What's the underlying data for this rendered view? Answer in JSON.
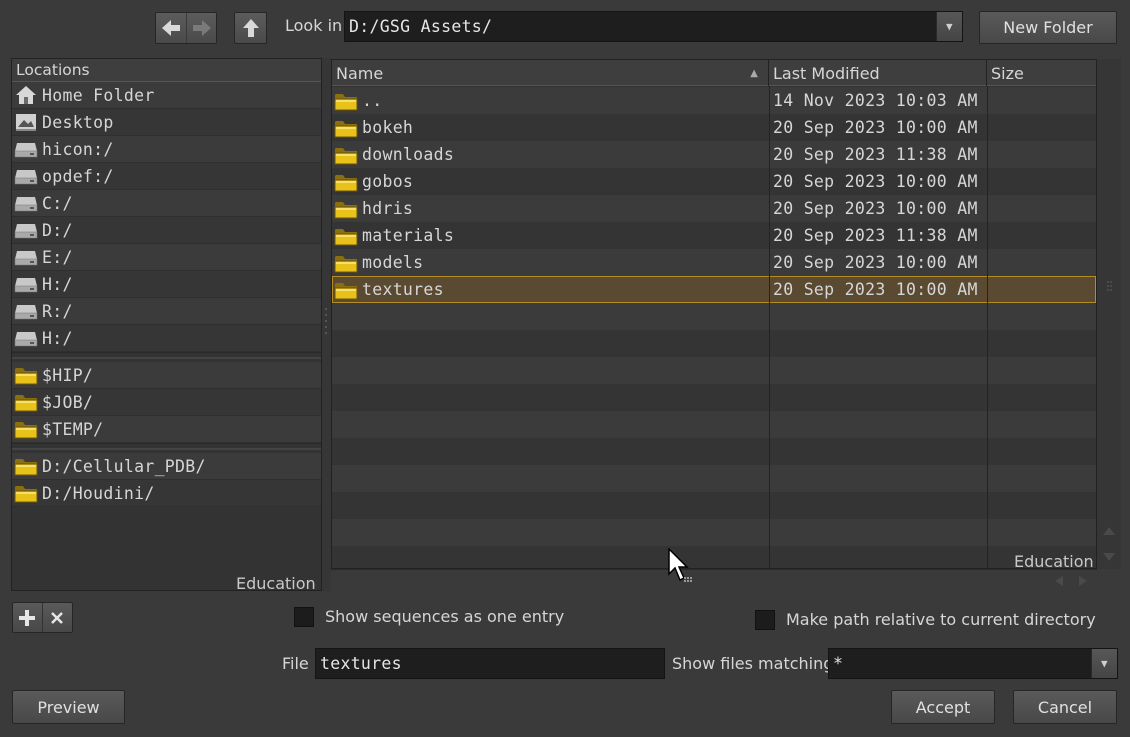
{
  "toolbar": {
    "back_icon": "arrow-left-icon",
    "forward_icon": "arrow-right-icon",
    "up_icon": "arrow-up-icon",
    "look_in_label": "Look in",
    "look_in_value": "D:/GSG Assets/",
    "new_folder_label": "New Folder"
  },
  "locations": {
    "header": "Locations",
    "items": [
      {
        "label": "Home Folder",
        "icon": "home-icon"
      },
      {
        "label": "Desktop",
        "icon": "desktop-icon"
      },
      {
        "label": "hicon:/",
        "icon": "drive-icon"
      },
      {
        "label": "opdef:/",
        "icon": "drive-icon"
      },
      {
        "label": "C:/",
        "icon": "drive-icon"
      },
      {
        "label": "D:/",
        "icon": "drive-icon"
      },
      {
        "label": "E:/",
        "icon": "drive-icon"
      },
      {
        "label": "H:/",
        "icon": "drive-icon"
      },
      {
        "label": "R:/",
        "icon": "drive-icon"
      },
      {
        "label": "H:/",
        "icon": "drive-icon"
      }
    ],
    "vars": [
      {
        "label": "$HIP/",
        "icon": "folder-icon"
      },
      {
        "label": "$JOB/",
        "icon": "folder-icon"
      },
      {
        "label": "$TEMP/",
        "icon": "folder-icon"
      }
    ],
    "favorites": [
      {
        "label": "D:/Cellular_PDB/",
        "icon": "folder-icon"
      },
      {
        "label": "D:/Houdini/",
        "icon": "folder-icon"
      }
    ],
    "watermark": "Education"
  },
  "files": {
    "columns": {
      "name": "Name",
      "modified": "Last Modified",
      "size": "Size"
    },
    "rows": [
      {
        "name": "..",
        "modified": "14 Nov 2023 10:03 AM",
        "size": ""
      },
      {
        "name": "bokeh",
        "modified": "20 Sep 2023 10:00 AM",
        "size": ""
      },
      {
        "name": "downloads",
        "modified": "20 Sep 2023 11:38 AM",
        "size": ""
      },
      {
        "name": "gobos",
        "modified": "20 Sep 2023 10:00 AM",
        "size": ""
      },
      {
        "name": "hdris",
        "modified": "20 Sep 2023 10:00 AM",
        "size": ""
      },
      {
        "name": "materials",
        "modified": "20 Sep 2023 11:38 AM",
        "size": ""
      },
      {
        "name": "models",
        "modified": "20 Sep 2023 10:00 AM",
        "size": ""
      },
      {
        "name": "textures",
        "modified": "20 Sep 2023 10:00 AM",
        "size": "",
        "selected": true
      }
    ],
    "watermark": "Education"
  },
  "options": {
    "show_sequences_label": "Show sequences as one entry",
    "relative_path_label": "Make path relative to current directory"
  },
  "bottom": {
    "file_label": "File",
    "file_value": "textures",
    "matching_label": "Show files matching",
    "matching_value": "*",
    "preview_label": "Preview",
    "accept_label": "Accept",
    "cancel_label": "Cancel",
    "add_location_icon": "plus-icon",
    "remove_location_icon": "x-icon"
  },
  "colors": {
    "background": "#3a3a3a",
    "selection": "#5a4a32",
    "selection_border": "#b58d22",
    "folder": "#e8c21a"
  }
}
